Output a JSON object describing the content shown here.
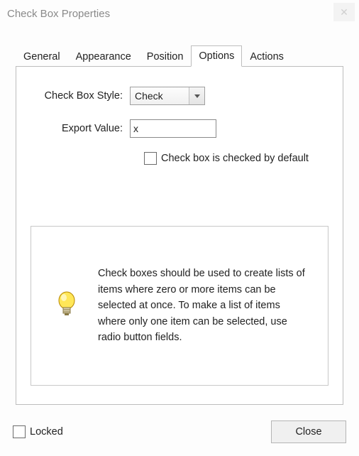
{
  "window": {
    "title": "Check Box Properties"
  },
  "tabs": {
    "general": "General",
    "appearance": "Appearance",
    "position": "Position",
    "options": "Options",
    "actions": "Actions",
    "active": "Options"
  },
  "form": {
    "style_label": "Check Box Style:",
    "style_value": "Check",
    "export_label": "Export Value:",
    "export_value": "x",
    "default_checked_label": "Check box is checked by default"
  },
  "tip": {
    "text": "Check boxes should be used to create lists of items where zero or more items can be selected at once. To make a list of items where only one item can be selected, use radio button fields."
  },
  "footer": {
    "locked_label": "Locked",
    "close_label": "Close"
  }
}
